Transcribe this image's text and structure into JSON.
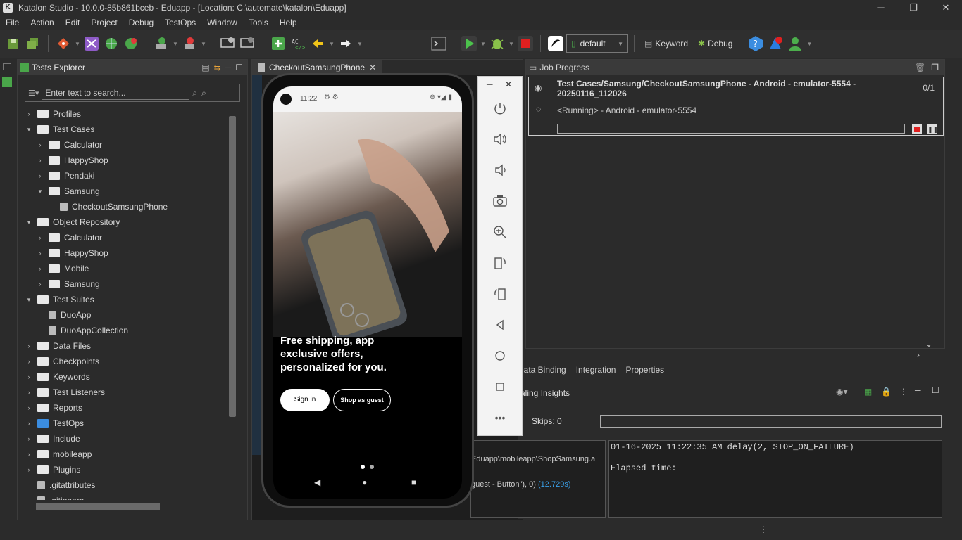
{
  "window": {
    "title": "Katalon Studio - 10.0.0-85b861bceb - Eduapp - [Location: C:\\automate\\katalon\\Eduapp]",
    "minimize": "─",
    "restore": "❐",
    "close": "✕"
  },
  "menu": [
    "File",
    "Action",
    "Edit",
    "Project",
    "Debug",
    "TestOps",
    "Window",
    "Tools",
    "Help"
  ],
  "toolbar": {
    "profile": "default",
    "keyword_label": "Keyword",
    "debug_label": "Debug"
  },
  "explorer": {
    "title": "Tests Explorer",
    "search_placeholder": "Enter text to search...",
    "tree": [
      {
        "label": "Profiles",
        "level": 0,
        "state": "collapsed",
        "icon": "profile-folder-icon"
      },
      {
        "label": "Test Cases",
        "level": 0,
        "state": "expanded",
        "icon": "folder-icon"
      },
      {
        "label": "Calculator",
        "level": 1,
        "state": "collapsed",
        "icon": "folder-icon"
      },
      {
        "label": "HappyShop",
        "level": 1,
        "state": "collapsed",
        "icon": "folder-icon"
      },
      {
        "label": "Pendaki",
        "level": 1,
        "state": "collapsed",
        "icon": "folder-icon"
      },
      {
        "label": "Samsung",
        "level": 1,
        "state": "expanded",
        "icon": "folder-icon"
      },
      {
        "label": "CheckoutSamsungPhone",
        "level": 2,
        "state": "leaf",
        "icon": "test-case-icon"
      },
      {
        "label": "Object Repository",
        "level": 0,
        "state": "expanded",
        "icon": "folder-icon"
      },
      {
        "label": "Calculator",
        "level": 1,
        "state": "collapsed",
        "icon": "folder-icon"
      },
      {
        "label": "HappyShop",
        "level": 1,
        "state": "collapsed",
        "icon": "folder-icon"
      },
      {
        "label": "Mobile",
        "level": 1,
        "state": "collapsed",
        "icon": "folder-icon"
      },
      {
        "label": "Samsung",
        "level": 1,
        "state": "collapsed",
        "icon": "folder-icon"
      },
      {
        "label": "Test Suites",
        "level": 0,
        "state": "expanded",
        "icon": "folder-icon"
      },
      {
        "label": "DuoApp",
        "level": 1,
        "state": "leaf",
        "icon": "test-suite-icon"
      },
      {
        "label": "DuoAppCollection",
        "level": 1,
        "state": "leaf",
        "icon": "test-suite-collection-icon"
      },
      {
        "label": "Data Files",
        "level": 0,
        "state": "collapsed",
        "icon": "folder-icon"
      },
      {
        "label": "Checkpoints",
        "level": 0,
        "state": "collapsed",
        "icon": "folder-icon"
      },
      {
        "label": "Keywords",
        "level": 0,
        "state": "collapsed",
        "icon": "folder-icon"
      },
      {
        "label": "Test Listeners",
        "level": 0,
        "state": "collapsed",
        "icon": "folder-icon"
      },
      {
        "label": "Reports",
        "level": 0,
        "state": "collapsed",
        "icon": "folder-icon"
      },
      {
        "label": "TestOps",
        "level": 0,
        "state": "collapsed",
        "icon": "testops-icon"
      },
      {
        "label": "Include",
        "level": 0,
        "state": "collapsed",
        "icon": "folder-icon"
      },
      {
        "label": "mobileapp",
        "level": 0,
        "state": "collapsed",
        "icon": "folder-icon"
      },
      {
        "label": "Plugins",
        "level": 0,
        "state": "collapsed",
        "icon": "folder-icon"
      },
      {
        "label": ".gitattributes",
        "level": 0,
        "state": "leaf",
        "icon": "file-icon"
      },
      {
        "label": ".gitignore",
        "level": 0,
        "state": "leaf",
        "icon": "file-icon"
      }
    ]
  },
  "editor": {
    "tab_label": "CheckoutSamsungPhone",
    "snippet_path": "Eduapp\\mobileapp\\ShopSamsung.a",
    "snippet_call": "guest - Button\"), 0)",
    "snippet_time": "(12.729s)"
  },
  "job_progress": {
    "title": "Job Progress",
    "job_path": "Test Cases/Samsung/CheckoutSamsungPhone - Android - emulator-5554 - 20250116_112026",
    "counter": "0/1",
    "status": "<Running> - Android - emulator-5554"
  },
  "bottom_tabs": [
    "Data Binding",
    "Integration",
    "Properties"
  ],
  "console": {
    "panel_title": "aling Insights",
    "skips_label": "Skips:",
    "skips_value": "0",
    "log_line": "01-16-2025 11:22:35 AM delay(2, STOP_ON_FAILURE)",
    "elapsed_label": "Elapsed time:"
  },
  "phone": {
    "time": "11:22",
    "headline": "Free shipping, app exclusive offers, personalized for you.",
    "sign_in": "Sign in",
    "guest": "Shop as guest"
  }
}
